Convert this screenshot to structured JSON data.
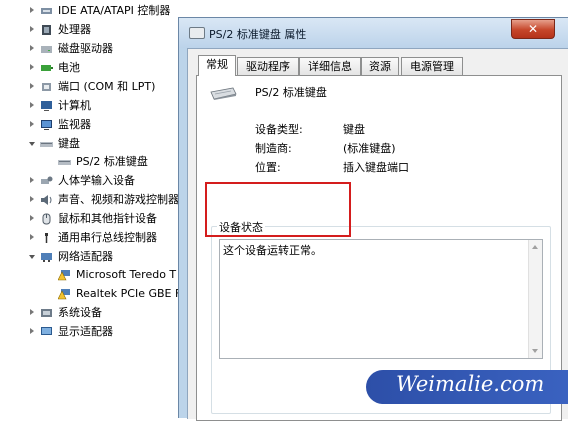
{
  "device_tree": {
    "items": [
      {
        "label": "IDE ATA/ATAPI 控制器",
        "state": "collapsed",
        "indent": 0,
        "icon": "ide-controller-icon"
      },
      {
        "label": "处理器",
        "state": "collapsed",
        "indent": 0,
        "icon": "processor-icon"
      },
      {
        "label": "磁盘驱动器",
        "state": "collapsed",
        "indent": 0,
        "icon": "disk-drive-icon"
      },
      {
        "label": "电池",
        "state": "collapsed",
        "indent": 0,
        "icon": "battery-icon"
      },
      {
        "label": "端口 (COM 和 LPT)",
        "state": "collapsed",
        "indent": 0,
        "icon": "port-icon"
      },
      {
        "label": "计算机",
        "state": "collapsed",
        "indent": 0,
        "icon": "computer-icon"
      },
      {
        "label": "监视器",
        "state": "collapsed",
        "indent": 0,
        "icon": "monitor-icon"
      },
      {
        "label": "键盘",
        "state": "expanded",
        "indent": 0,
        "icon": "keyboard-icon"
      },
      {
        "label": "PS/2 标准键盘",
        "state": "leaf",
        "indent": 1,
        "icon": "keyboard-icon"
      },
      {
        "label": "人体学输入设备",
        "state": "collapsed",
        "indent": 0,
        "icon": "hid-icon"
      },
      {
        "label": "声音、视频和游戏控制器",
        "state": "collapsed",
        "indent": 0,
        "icon": "sound-icon"
      },
      {
        "label": "鼠标和其他指针设备",
        "state": "collapsed",
        "indent": 0,
        "icon": "mouse-icon"
      },
      {
        "label": "通用串行总线控制器",
        "state": "collapsed",
        "indent": 0,
        "icon": "usb-icon"
      },
      {
        "label": "网络适配器",
        "state": "expanded",
        "indent": 0,
        "icon": "network-adapter-icon"
      },
      {
        "label": "Microsoft Teredo T",
        "state": "leaf",
        "indent": 1,
        "icon": "warning-network-icon"
      },
      {
        "label": "Realtek PCIe GBE F",
        "state": "leaf",
        "indent": 1,
        "icon": "warning-network-icon"
      },
      {
        "label": "系统设备",
        "state": "collapsed",
        "indent": 0,
        "icon": "system-device-icon"
      },
      {
        "label": "显示适配器",
        "state": "collapsed",
        "indent": 0,
        "icon": "display-adapter-icon"
      }
    ]
  },
  "dialog": {
    "title": "PS/2 标准键盘 属性",
    "close_label": "✕",
    "tabs": [
      {
        "label": "常规",
        "active": true
      },
      {
        "label": "驱动程序",
        "active": false
      },
      {
        "label": "详细信息",
        "active": false
      },
      {
        "label": "资源",
        "active": false
      },
      {
        "label": "电源管理",
        "active": false
      }
    ],
    "device_name": "PS/2 标准键盘",
    "properties": [
      {
        "label": "设备类型:",
        "value": "键盘"
      },
      {
        "label": "制造商:",
        "value": "(标准键盘)"
      },
      {
        "label": "位置:",
        "value": "插入键盘端口"
      }
    ],
    "status_title": "设备状态",
    "status_text": "这个设备运转正常。"
  },
  "watermark": {
    "text": "Weimalie.com"
  },
  "colors": {
    "highlight": "#d41d1d",
    "dialog_frame": "#bcd4ea",
    "watermark_bg": "#3a62c0"
  }
}
